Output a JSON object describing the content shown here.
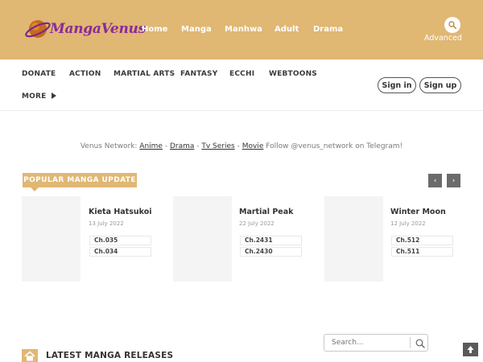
{
  "header": {
    "logo_text": "MangaVenus",
    "nav": [
      "Home",
      "Manga",
      "Manhwa",
      "Adult",
      "Drama"
    ],
    "advanced_label": "Advanced"
  },
  "secnav": {
    "items": [
      "DONATE",
      "ACTION",
      "MARTIAL ARTS",
      "FANTASY",
      "ECCHI",
      "WEBTOONS"
    ],
    "more_label": "MORE",
    "signin_label": "Sign in",
    "signup_label": "Sign up"
  },
  "network": {
    "prefix": "Venus Network:",
    "links": [
      "Anime",
      "Drama",
      "Tv Series",
      "Movie"
    ],
    "separator": " - ",
    "suffix": "Follow @venus_network on Telegram!"
  },
  "popular": {
    "heading": "POPULAR MANGA UPDATE",
    "prev_label": "‹",
    "next_label": "›",
    "cards": [
      {
        "title": "Kieta Hatsukoi",
        "date": "13 July 2022",
        "chapters": [
          "Ch.035",
          "Ch.034"
        ]
      },
      {
        "title": "Martial Peak",
        "date": "22 July 2022",
        "chapters": [
          "Ch.2431",
          "Ch.2430"
        ]
      },
      {
        "title": "Winter Moon",
        "date": "12 July 2022",
        "chapters": [
          "Ch.512",
          "Ch.511"
        ]
      }
    ]
  },
  "latest": {
    "title": "LATEST MANGA RELEASES",
    "search_placeholder": "Search..."
  },
  "colors": {
    "brand": "#e0b773",
    "logo_purple": "#8a2a9a",
    "button_dark": "#6b6b6b"
  }
}
